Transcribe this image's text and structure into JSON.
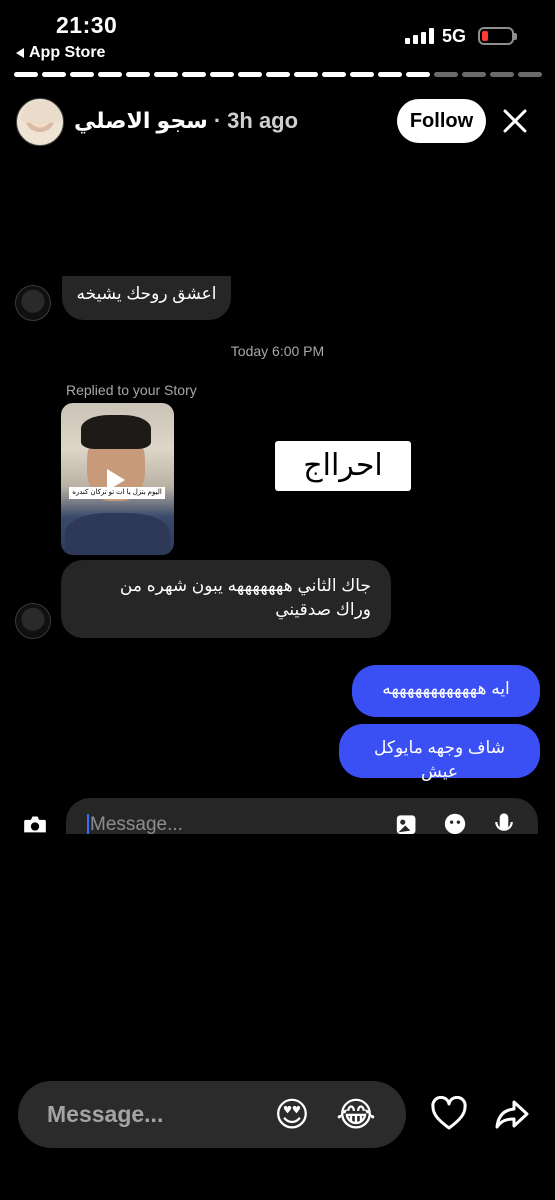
{
  "status_bar": {
    "time": "21:30",
    "back_app": "App Store",
    "network": "5G"
  },
  "story": {
    "progress": 0.77,
    "username": "سجو الاصلي",
    "separator": "·",
    "posted_ago": "3h ago",
    "follow_label": "Follow"
  },
  "chat": {
    "top_message": "اعشق روحك يشيخه",
    "date_separator": "Today 6:00 PM",
    "reply_label": "Replied to your Story",
    "story_caption": "اليوم بتزل يا ات تو تركان كندره",
    "sticker_text": "احرااج",
    "incoming_message": "جاك الثاني هههههههه يبون شهره من وراك صدقيني",
    "outgoing_messages": [
      "ايه ههههههههههههه",
      "شاف وجهه مايوكل عيش"
    ],
    "composer_placeholder": "Message..."
  },
  "reply_bar": {
    "placeholder": "Message...",
    "emoji_1": "😍",
    "emoji_2": "😂"
  },
  "colors": {
    "background": "#000000",
    "outgoing_bubble": "#3a50f5",
    "incoming_bubble": "#262626",
    "battery_low": "#ff3b30"
  }
}
